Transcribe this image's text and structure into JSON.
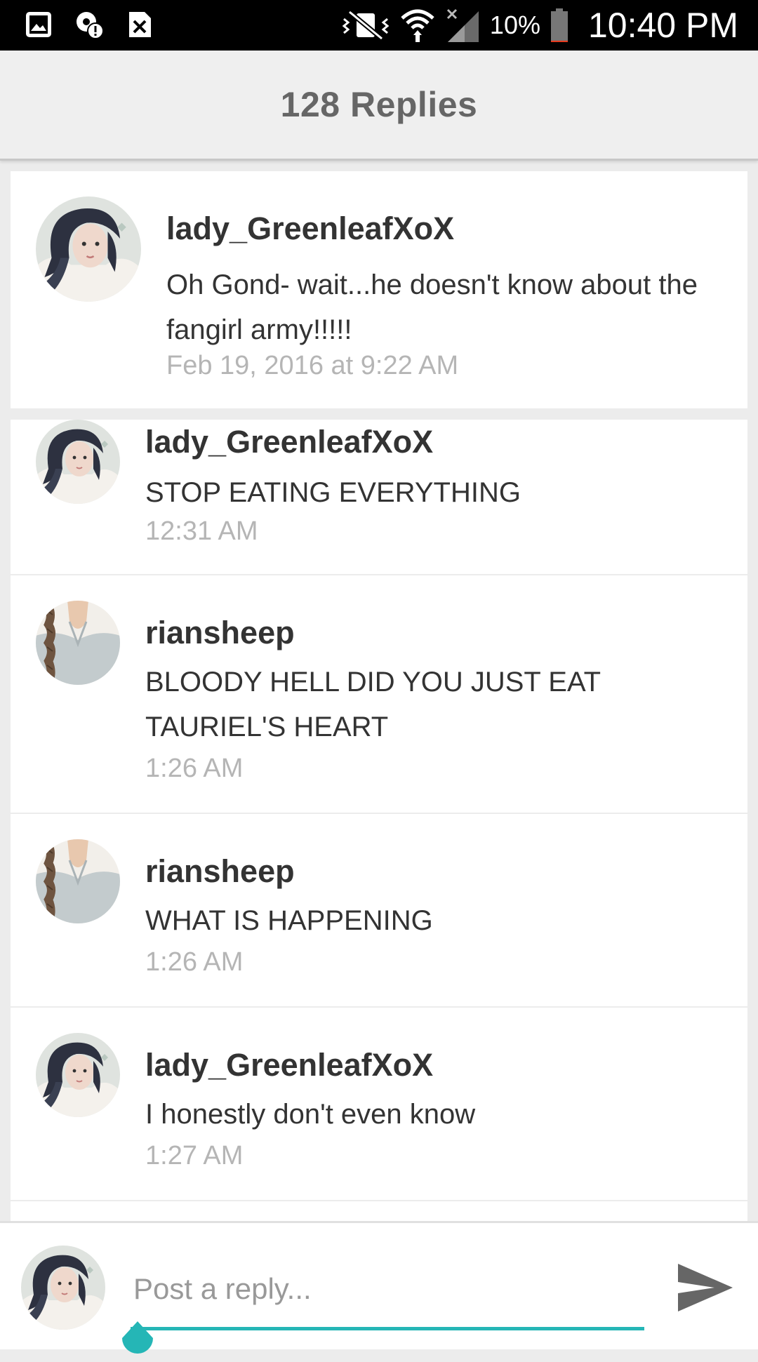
{
  "status_bar": {
    "battery_percent": "10%",
    "battery_level": 0.1,
    "time": "10:40 PM",
    "left_icons": [
      "gallery-icon",
      "location-alert-icon",
      "close-box-icon"
    ],
    "right_icons": [
      "vibrate-off-icon",
      "wifi-icon",
      "signal-icon",
      "battery-icon"
    ]
  },
  "header": {
    "title": "128 Replies"
  },
  "original_post": {
    "username": "lady_GreenleafXoX",
    "text": "Oh Gond- wait...he doesn't know about the fangirl army!!!!!",
    "timestamp": "Feb 19, 2016 at 9:22 AM"
  },
  "replies": [
    {
      "username": "lady_GreenleafXoX",
      "text": "STOP EATING EVERYTHING",
      "time": "12:31 AM",
      "avatar": "dark-haired-girl"
    },
    {
      "username": "riansheep",
      "text": "BLOODY HELL DID YOU JUST EAT TAURIEL'S HEART",
      "time": "1:26 AM",
      "avatar": "braid-sweater"
    },
    {
      "username": "riansheep",
      "text": "WHAT IS HAPPENING",
      "time": "1:26 AM",
      "avatar": "braid-sweater"
    },
    {
      "username": "lady_GreenleafXoX",
      "text": "I honestly don't even know",
      "time": "1:27 AM",
      "avatar": "dark-haired-girl"
    }
  ],
  "composer": {
    "placeholder": "Post a reply...",
    "value": ""
  },
  "colors": {
    "accent": "#25b6b6",
    "header_bg": "#efefef",
    "timestamp": "#b5b5b5",
    "title": "#666666"
  }
}
